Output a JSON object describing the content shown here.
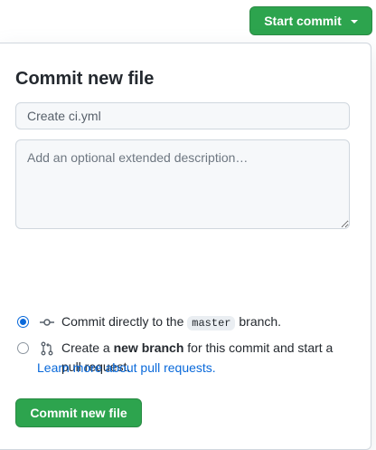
{
  "header": {
    "start_commit_label": "Start commit",
    "start_commit_icon": "triangle-down-icon"
  },
  "commit_form": {
    "title": "Commit new file",
    "summary_value": "Create ci.yml",
    "description_placeholder": "Add an optional extended description…",
    "options": [
      {
        "selected": true,
        "icon": "git-commit-icon",
        "text_before": "Commit directly to the",
        "branch": "master",
        "text_after": "branch."
      },
      {
        "selected": false,
        "icon": "git-pull-request-icon",
        "text_before": "Create a",
        "bold": "new branch",
        "text_after": "for this commit and start a pull request.",
        "link": "Learn more about pull requests."
      }
    ],
    "submit_label": "Commit new file"
  },
  "colors": {
    "primary_green": "#2da44e",
    "link_blue": "#0969da",
    "border": "#d0d7de"
  }
}
